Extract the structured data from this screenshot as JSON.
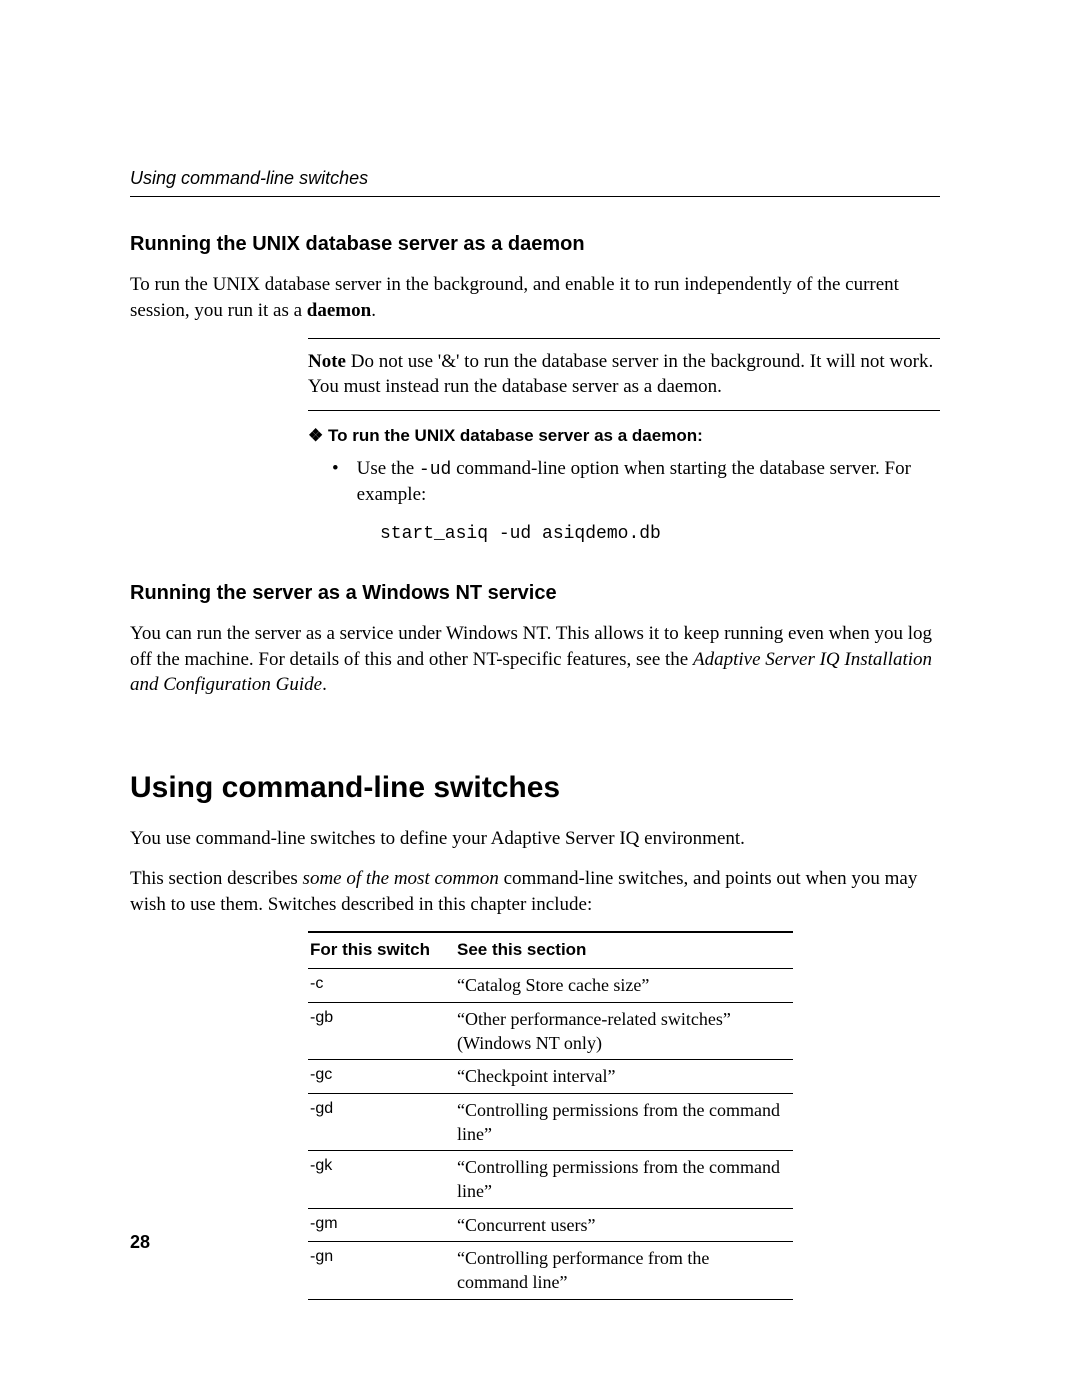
{
  "header": {
    "running": "Using command-line switches"
  },
  "section1": {
    "heading": "Running the UNIX database server as a daemon",
    "p1a": "To run the UNIX database server in the background, and enable it to run independently of the current session, you run it as a ",
    "p1b": "daemon",
    "p1c": ".",
    "note_label": "Note",
    "note_body": "  Do not use '&' to run the database server in the background. It will not work. You must instead run the database server as a daemon.",
    "sub_diamond": "❖",
    "subhead": "To run the UNIX database server as a daemon:",
    "bullet": "•",
    "bul_a": "Use the ",
    "bul_code": "-ud",
    "bul_b": " command-line option when starting the database server. For example:",
    "code": "start_asiq -ud asiqdemo.db"
  },
  "section2": {
    "heading": "Running the server as a Windows NT service",
    "p_a": "You can run the server as a service under Windows NT. This allows it to keep running even when you log off the machine. For details of this and other NT-specific features, see the ",
    "p_b": "Adaptive Server IQ Installation and Configuration Guide",
    "p_c": "."
  },
  "main": {
    "title": "Using command-line switches",
    "p1": "You use command-line switches to define your Adaptive Server IQ environment.",
    "p2a": "This section describes ",
    "p2b": "some of the most common",
    "p2c": " command-line switches, and points out when you may wish to use them. Switches described in this chapter include:",
    "th1": "For this switch",
    "th2": "See this section",
    "rows": [
      {
        "sw": "-c",
        "desc": "“Catalog Store cache size”"
      },
      {
        "sw": "-gb",
        "desc": "“Other performance-related switches” (Windows NT only)"
      },
      {
        "sw": "-gc",
        "desc": "“Checkpoint interval”"
      },
      {
        "sw": "-gd",
        "desc": "“Controlling permissions from the command line”"
      },
      {
        "sw": "-gk",
        "desc": "“Controlling permissions from the command line”"
      },
      {
        "sw": "-gm",
        "desc": "“Concurrent users”"
      },
      {
        "sw": "-gn",
        "desc": "“Controlling performance from the command line”"
      }
    ]
  },
  "page_number": "28"
}
